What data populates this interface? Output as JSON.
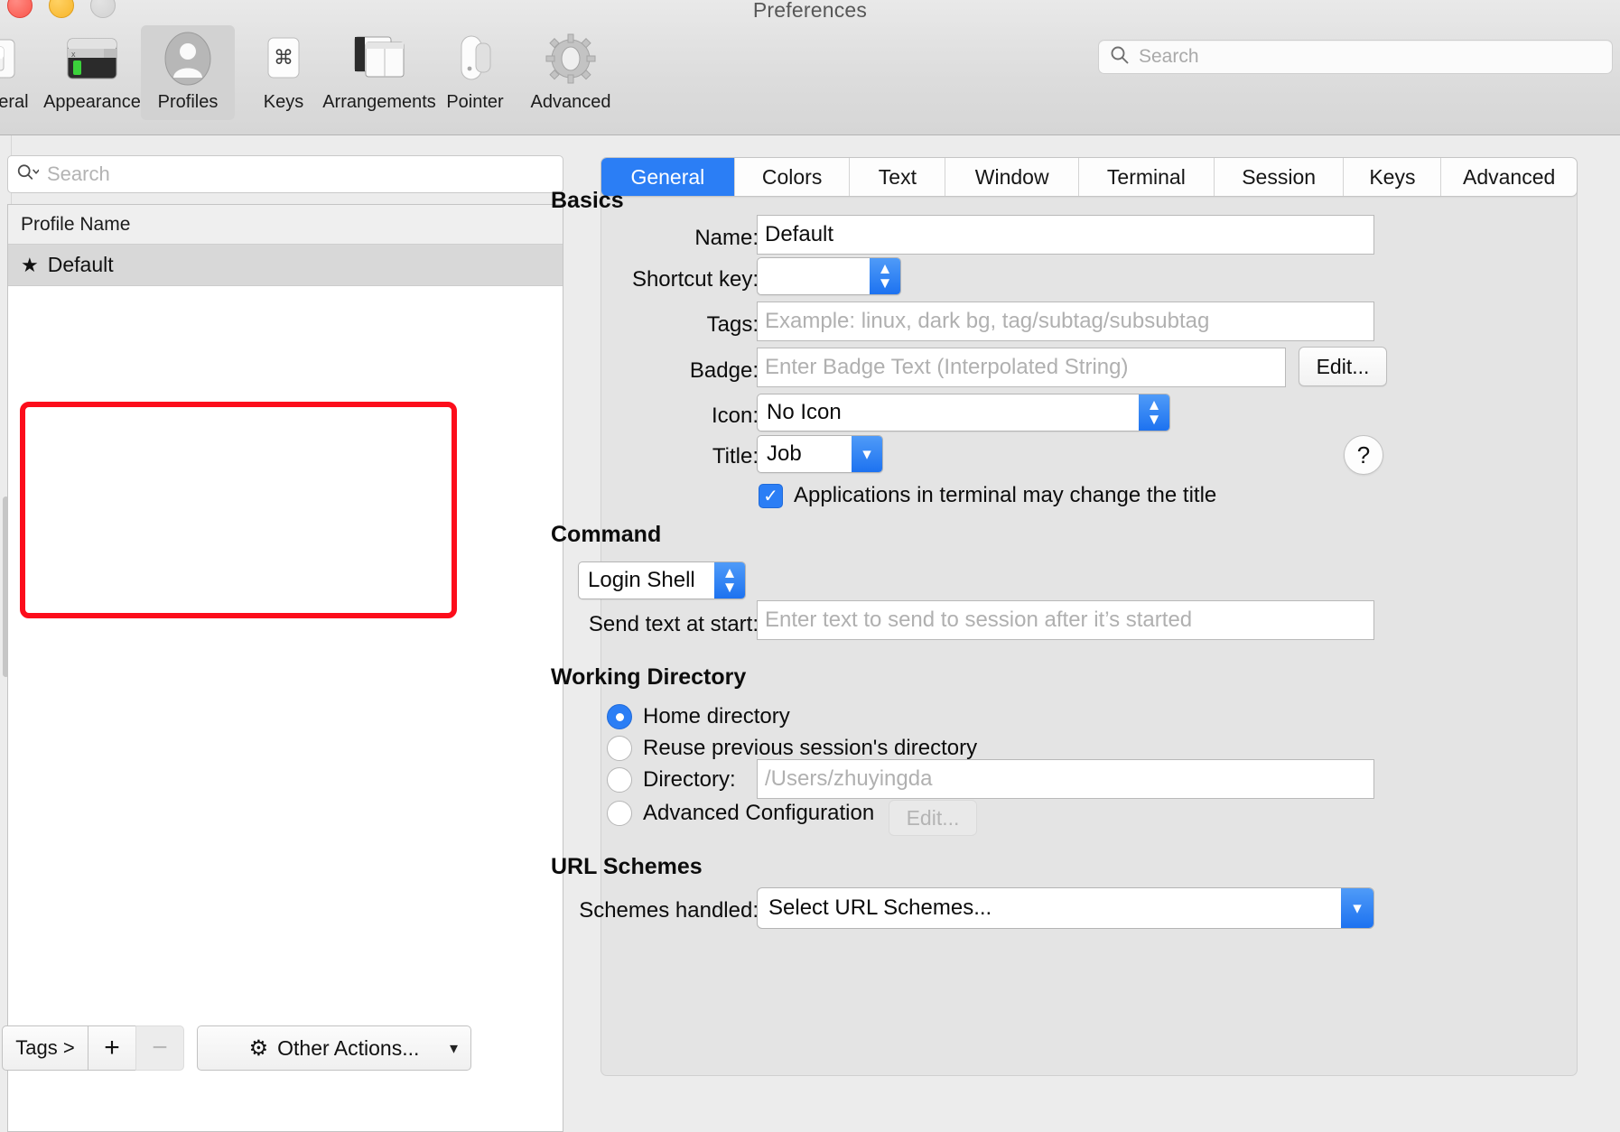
{
  "window": {
    "title": "Preferences",
    "traffic_lights": [
      "close",
      "minimize",
      "zoom"
    ]
  },
  "toolbar": {
    "items": [
      {
        "label": "General",
        "icon": "general-icon",
        "selected": false
      },
      {
        "label": "Appearance",
        "icon": "appearance-icon",
        "selected": false
      },
      {
        "label": "Profiles",
        "icon": "profiles-icon",
        "selected": true
      },
      {
        "label": "Keys",
        "icon": "keys-icon",
        "selected": false
      },
      {
        "label": "Arrangements",
        "icon": "arrangements-icon",
        "selected": false
      },
      {
        "label": "Pointer",
        "icon": "pointer-icon",
        "selected": false
      },
      {
        "label": "Advanced",
        "icon": "advanced-icon",
        "selected": false
      }
    ],
    "search_placeholder": "Search"
  },
  "sidebar": {
    "search_placeholder": "Search",
    "column_header": "Profile Name",
    "rows": [
      {
        "name": "Default",
        "starred": true,
        "selected": true
      }
    ],
    "bottom_bar": {
      "tags_label": "Tags >",
      "add_label": "+",
      "remove_label": "−",
      "other_actions_label": "Other Actions..."
    }
  },
  "main": {
    "tabs": [
      {
        "label": "General",
        "active": true
      },
      {
        "label": "Colors",
        "active": false
      },
      {
        "label": "Text",
        "active": false
      },
      {
        "label": "Window",
        "active": false
      },
      {
        "label": "Terminal",
        "active": false
      },
      {
        "label": "Session",
        "active": false
      },
      {
        "label": "Keys",
        "active": false
      },
      {
        "label": "Advanced",
        "active": false
      }
    ],
    "basics": {
      "heading": "Basics",
      "name_label": "Name:",
      "name_value": "Default",
      "shortcut_label": "Shortcut key:",
      "shortcut_value": "",
      "tags_label": "Tags:",
      "tags_placeholder": "Example: linux, dark bg, tag/subtag/subsubtag",
      "badge_label": "Badge:",
      "badge_placeholder": "Enter Badge Text (Interpolated String)",
      "badge_edit_label": "Edit...",
      "icon_label": "Icon:",
      "icon_value": "No Icon",
      "title_label": "Title:",
      "title_value": "Job",
      "help_label": "?",
      "change_title_checkbox": "Applications in terminal may change the title",
      "change_title_checked": true
    },
    "command": {
      "heading": "Command",
      "command_value": "Login Shell",
      "send_text_label": "Send text at start:",
      "send_text_placeholder": "Enter text to send to session after it’s started"
    },
    "working_directory": {
      "heading": "Working Directory",
      "options": [
        {
          "label": "Home directory",
          "selected": true
        },
        {
          "label": "Reuse previous session's directory",
          "selected": false
        },
        {
          "label": "Directory:",
          "selected": false
        },
        {
          "label": "Advanced Configuration",
          "selected": false
        }
      ],
      "directory_placeholder": "/Users/zhuyingda",
      "advanced_edit_label": "Edit...",
      "advanced_edit_disabled": true
    },
    "url_schemes": {
      "heading": "URL Schemes",
      "schemes_label": "Schemes handled:",
      "schemes_value": "Select URL Schemes..."
    }
  },
  "annotation": {
    "highlight_color": "#fc0d1b"
  }
}
